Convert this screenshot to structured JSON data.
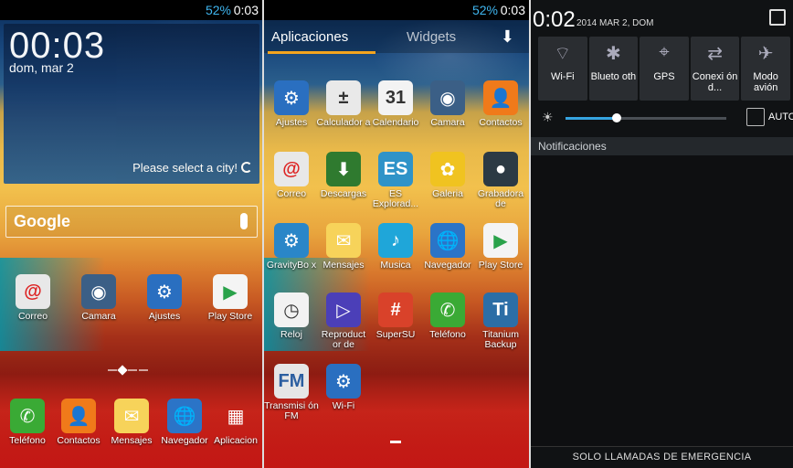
{
  "statusbar": {
    "battery": "52%",
    "time": "0:03"
  },
  "home": {
    "clock": {
      "time": "00:03",
      "date": "dom, mar 2",
      "city_prompt": "Please select a city!"
    },
    "search": {
      "logo": "Google"
    },
    "apps": [
      {
        "label": "Correo",
        "icon": "email-icon",
        "color": "#e8e8e8",
        "fg": "#d22",
        "glyph": "@"
      },
      {
        "label": "Camara",
        "icon": "camera-icon",
        "color": "#3b5f86",
        "fg": "#fff",
        "glyph": "◉"
      },
      {
        "label": "Ajustes",
        "icon": "settings-gear-icon",
        "color": "#2a6fc0",
        "fg": "#fff",
        "glyph": "⚙"
      },
      {
        "label": "Play Store",
        "icon": "play-store-icon",
        "color": "#f4f4f4",
        "fg": "#2aa24a",
        "glyph": "▶"
      }
    ],
    "dock": [
      {
        "label": "Teléfono",
        "icon": "phone-icon",
        "color": "#3aaa35",
        "fg": "#fff",
        "glyph": "✆"
      },
      {
        "label": "Contactos",
        "icon": "contacts-icon",
        "color": "#f07a1a",
        "fg": "#fff",
        "glyph": "👤"
      },
      {
        "label": "Mensajes",
        "icon": "messages-icon",
        "color": "#f7d35a",
        "fg": "#fff",
        "glyph": "✉"
      },
      {
        "label": "Navegador",
        "icon": "browser-globe-icon",
        "color": "#2b74c7",
        "fg": "#fff",
        "glyph": "🌐"
      },
      {
        "label": "Aplicacion",
        "icon": "apps-grid-icon",
        "color": "transparent",
        "fg": "#fff",
        "glyph": "▦"
      }
    ]
  },
  "drawer": {
    "tabs": {
      "apps": "Aplicaciones",
      "widgets": "Widgets"
    },
    "apps": [
      {
        "label": "Ajustes",
        "icon": "settings-gear-icon",
        "color": "#2a6fc0",
        "fg": "#fff",
        "glyph": "⚙"
      },
      {
        "label": "Calculador a",
        "icon": "calculator-icon",
        "color": "#e9e9e9",
        "fg": "#333",
        "glyph": "±"
      },
      {
        "label": "Calendario",
        "icon": "calendar-icon",
        "color": "#f3f3f3",
        "fg": "#333",
        "glyph": "31"
      },
      {
        "label": "Camara",
        "icon": "camera-icon",
        "color": "#3b5f86",
        "fg": "#fff",
        "glyph": "◉"
      },
      {
        "label": "Contactos",
        "icon": "contacts-icon",
        "color": "#f07a1a",
        "fg": "#fff",
        "glyph": "👤"
      },
      {
        "label": "Correo",
        "icon": "email-icon",
        "color": "#e8e8e8",
        "fg": "#d22",
        "glyph": "@"
      },
      {
        "label": "Descargas",
        "icon": "downloads-icon",
        "color": "#2f7a2f",
        "fg": "#fff",
        "glyph": "⬇"
      },
      {
        "label": "ES Explorad...",
        "icon": "es-explorer-icon",
        "color": "#2f93c8",
        "fg": "#fff",
        "glyph": "ES"
      },
      {
        "label": "Galeria",
        "icon": "gallery-icon",
        "color": "#f0c320",
        "fg": "#fff",
        "glyph": "✿"
      },
      {
        "label": "Grabadora de",
        "icon": "recorder-icon",
        "color": "#2c3a44",
        "fg": "#fff",
        "glyph": "●"
      },
      {
        "label": "GravityBo x",
        "icon": "gravitybox-icon",
        "color": "#2a86c8",
        "fg": "#fff",
        "glyph": "⚙"
      },
      {
        "label": "Mensajes",
        "icon": "messages-icon",
        "color": "#f7d35a",
        "fg": "#fff",
        "glyph": "✉"
      },
      {
        "label": "Musica",
        "icon": "music-icon",
        "color": "#1fa6d9",
        "fg": "#fff",
        "glyph": "♪"
      },
      {
        "label": "Navegador",
        "icon": "browser-globe-icon",
        "color": "#2b74c7",
        "fg": "#fff",
        "glyph": "🌐"
      },
      {
        "label": "Play Store",
        "icon": "play-store-icon",
        "color": "#f4f4f4",
        "fg": "#2aa24a",
        "glyph": "▶"
      },
      {
        "label": "Reloj",
        "icon": "clock-icon",
        "color": "#f2f2f2",
        "fg": "#333",
        "glyph": "◷"
      },
      {
        "label": "Reproduct or de",
        "icon": "video-player-icon",
        "color": "#4b3fb8",
        "fg": "#fff",
        "glyph": "▷"
      },
      {
        "label": "SuperSU",
        "icon": "supersu-icon",
        "color": "#d9422a",
        "fg": "#fff",
        "glyph": "#"
      },
      {
        "label": "Teléfono",
        "icon": "phone-icon",
        "color": "#3aaa35",
        "fg": "#fff",
        "glyph": "✆"
      },
      {
        "label": "Titanium Backup",
        "icon": "titanium-backup-icon",
        "color": "#2c6ea6",
        "fg": "#fff",
        "glyph": "Ti"
      },
      {
        "label": "Transmisi ón FM",
        "icon": "fm-radio-icon",
        "color": "#e6e6e6",
        "fg": "#2b5ea0",
        "glyph": "FM"
      },
      {
        "label": "Wi-Fi",
        "icon": "wifi-settings-icon",
        "color": "#2a6fc0",
        "fg": "#fff",
        "glyph": "⚙"
      }
    ]
  },
  "quick_settings": {
    "time": "0:02",
    "date": "2014 MAR 2, DOM",
    "tiles": [
      {
        "label": "Wi-Fi",
        "icon": "wifi-icon",
        "glyph": "⌔"
      },
      {
        "label": "Blueto oth",
        "icon": "bluetooth-icon",
        "glyph": "✱"
      },
      {
        "label": "GPS",
        "icon": "gps-icon",
        "glyph": "⌖"
      },
      {
        "label": "Conexi ón d...",
        "icon": "data-connection-icon",
        "glyph": "⇄"
      },
      {
        "label": "Modo avión",
        "icon": "airplane-icon",
        "glyph": "✈"
      }
    ],
    "brightness": {
      "level": 0.32,
      "auto_label": "AUTO"
    },
    "notifications_header": "Notificaciones",
    "emergency": "SOLO LLAMADAS DE EMERGENCIA"
  }
}
